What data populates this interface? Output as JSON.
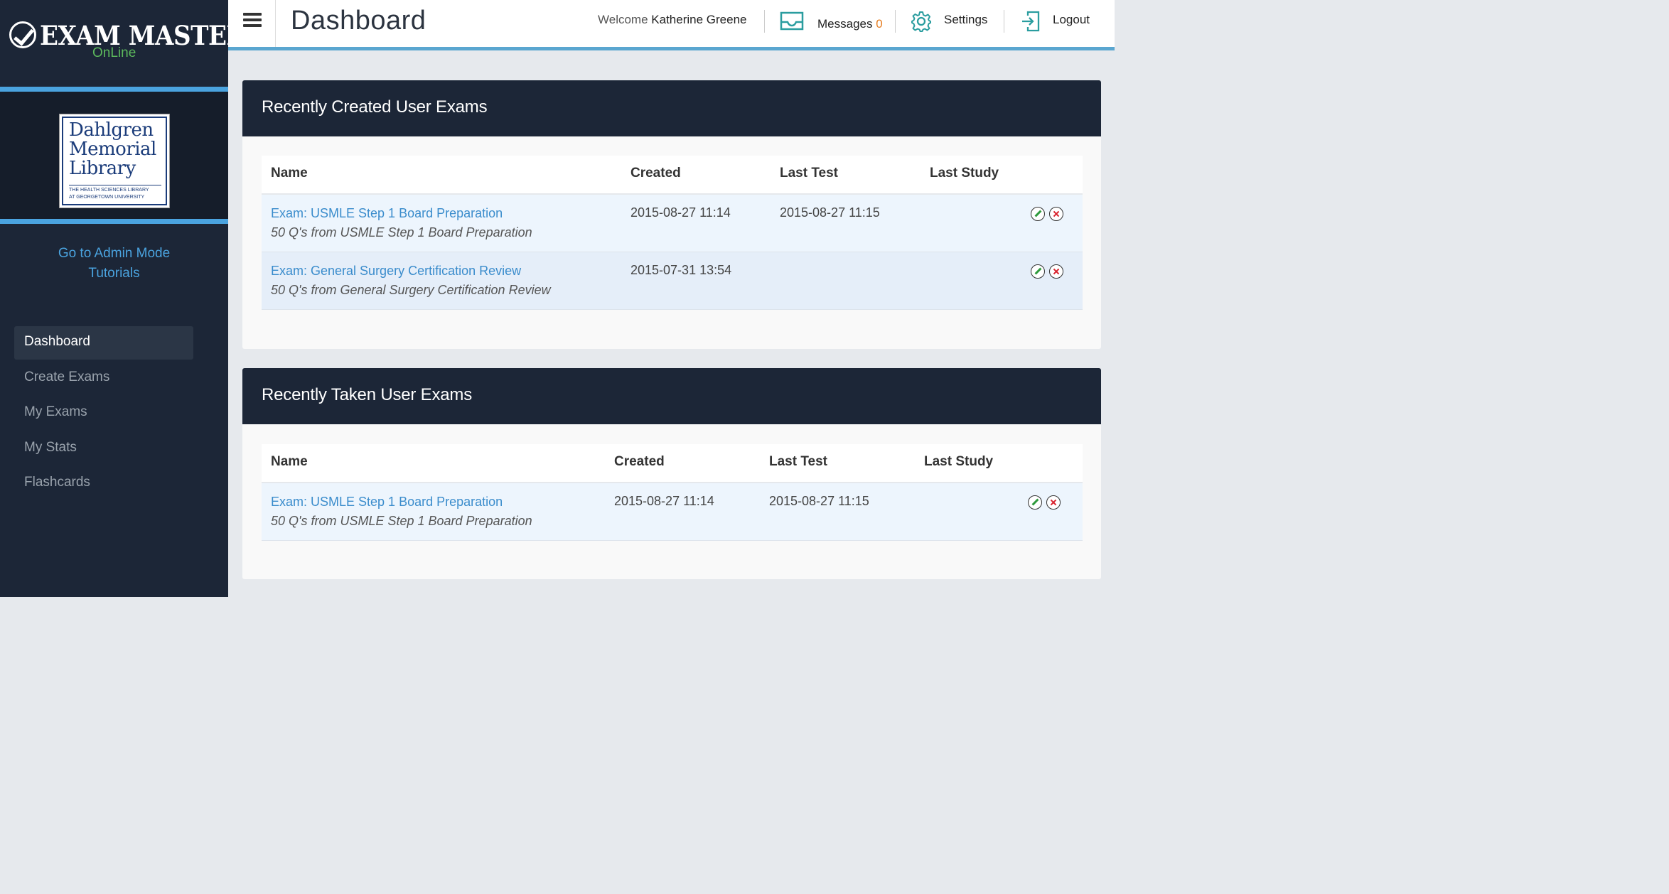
{
  "brand": {
    "name": "EXAM MASTER",
    "registered": "®",
    "subtitle": "OnLine"
  },
  "library": {
    "line1": "Dahlgren",
    "line2": "Memorial",
    "line3": "Library",
    "tagline1": "The Health Sciences Library",
    "tagline2": "at Georgetown University"
  },
  "sidebar": {
    "links": [
      "Go to Admin Mode",
      "Tutorials"
    ],
    "nav": [
      {
        "label": "Dashboard",
        "active": true
      },
      {
        "label": "Create Exams",
        "active": false
      },
      {
        "label": "My Exams",
        "active": false
      },
      {
        "label": "My Stats",
        "active": false
      },
      {
        "label": "Flashcards",
        "active": false
      }
    ]
  },
  "header": {
    "title": "Dashboard",
    "welcome_prefix": "Welcome",
    "user_name": "Katherine Greene",
    "messages_label": "Messages",
    "messages_count": "0",
    "settings_label": "Settings",
    "logout_label": "Logout"
  },
  "columns": {
    "name": "Name",
    "created": "Created",
    "last_test": "Last Test",
    "last_study": "Last Study"
  },
  "created_panel": {
    "title": "Recently Created User Exams",
    "rows": [
      {
        "name": "Exam: USMLE Step 1 Board Preparation",
        "description": "50 Q's from USMLE Step 1 Board Preparation",
        "created": "2015-08-27 11:14",
        "last_test": "2015-08-27 11:15",
        "last_study": ""
      },
      {
        "name": "Exam: General Surgery Certification Review",
        "description": "50 Q's from General Surgery Certification Review",
        "created": "2015-07-31 13:54",
        "last_test": "",
        "last_study": ""
      }
    ]
  },
  "taken_panel": {
    "title": "Recently Taken User Exams",
    "rows": [
      {
        "name": "Exam: USMLE Step 1 Board Preparation",
        "description": "50 Q's from USMLE Step 1 Board Preparation",
        "created": "2015-08-27 11:14",
        "last_test": "2015-08-27 11:15",
        "last_study": ""
      }
    ]
  },
  "colors": {
    "sidebar_bg": "#1c2637",
    "accent_blue": "#4aa3df",
    "brand_green": "#5cb85c",
    "messages_orange": "#e67e22",
    "link_blue": "#3a8ccc"
  },
  "icons": {
    "menu": "hamburger-icon",
    "messages": "inbox-icon",
    "settings": "gear-icon",
    "logout": "logout-icon",
    "edit": "pencil-icon",
    "delete": "close-icon"
  }
}
